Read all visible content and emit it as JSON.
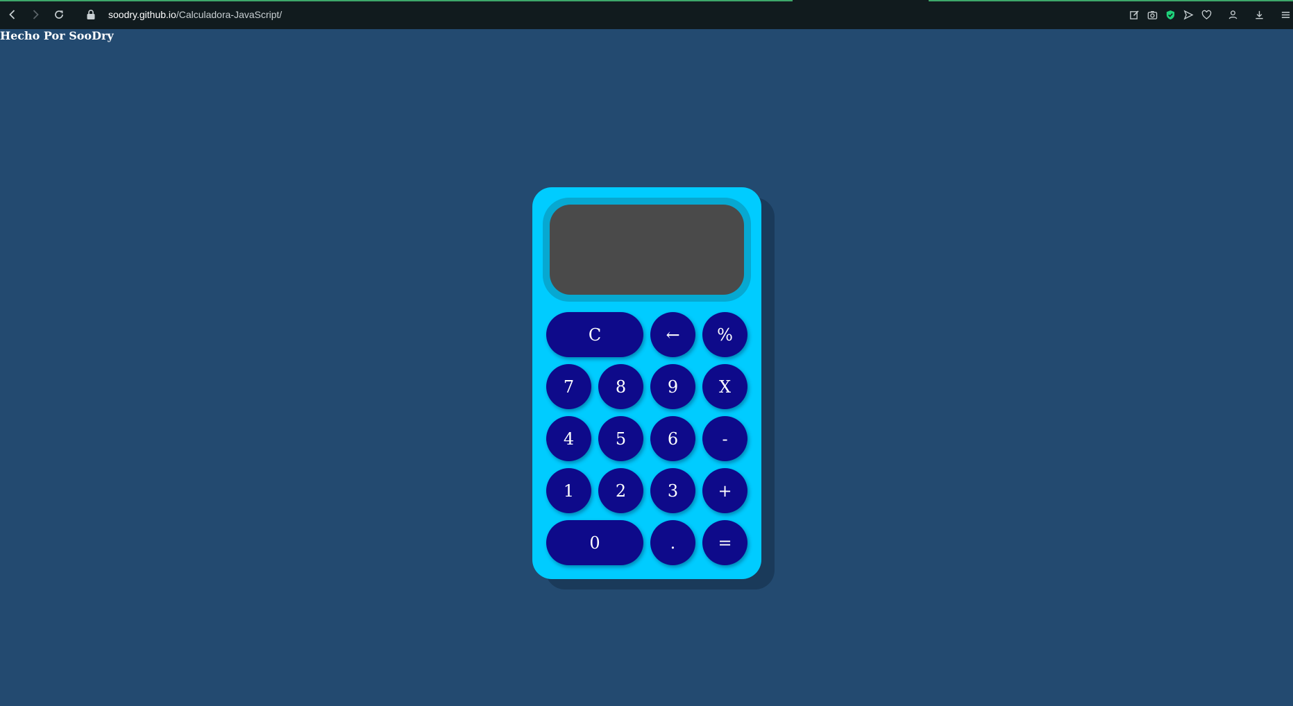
{
  "browser": {
    "url_host": "soodry.github.io",
    "url_path": "/Calculadora-JavaScript/"
  },
  "page": {
    "credit": "Hecho Por SooDry"
  },
  "calculator": {
    "display_value": "",
    "keys": {
      "clear": "C",
      "backspace": "←",
      "percent": "%",
      "seven": "7",
      "eight": "8",
      "nine": "9",
      "multiply": "X",
      "four": "4",
      "five": "5",
      "six": "6",
      "minus": "-",
      "one": "1",
      "two": "2",
      "three": "3",
      "plus": "+",
      "zero": "0",
      "dot": ".",
      "equals": "="
    }
  },
  "colors": {
    "page_background": "#234a70",
    "calculator_body": "#00ccff",
    "display_frame": "#07a8d1",
    "display": "#4a4a4a",
    "key": "#0e0a8a",
    "key_text": "#ffffff",
    "browser_chrome": "#111b1e",
    "extension_accent": "#1fd17a"
  }
}
